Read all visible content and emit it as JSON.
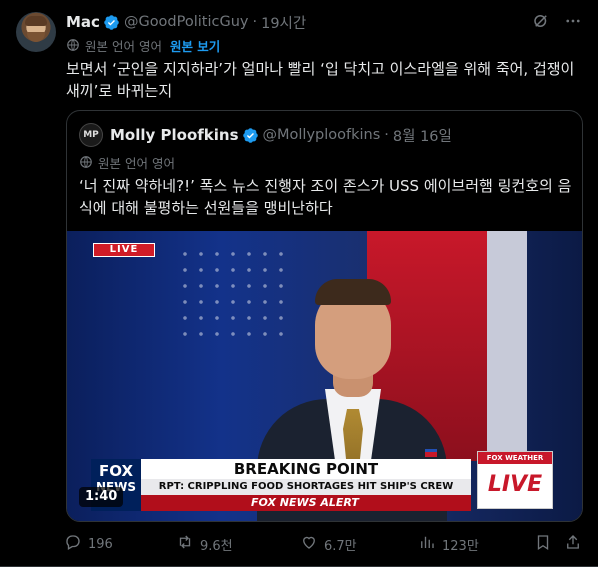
{
  "author": {
    "name": "Mac",
    "handle": "@GoodPoliticGuy",
    "separator": "·",
    "time": "19시간"
  },
  "translation": {
    "label": "원본 언어 영어",
    "show_original": "원본 보기"
  },
  "tweet_text": "보면서 ‘군인을 지지하라’가 얼마나 빨리 ‘입 닥치고 이스라엘을 위해 죽어, 겁쟁이 새끼’로 바뀌는지",
  "quoted": {
    "avatar_text": "MP",
    "name": "Molly Ploofkins",
    "handle": "@Mollyploofkins",
    "separator": "·",
    "date": "8월 16일",
    "translation_label": "원본 언어 영어",
    "text": "‘너 진짜 약하네?!’ 폭스 뉴스 진행자 조이 존스가 USS 에이브러햄 링컨호의 음식에 대해 불평하는 선원들을 맹비난하다"
  },
  "video": {
    "live_tag": "LIVE",
    "logo_line1": "FOX",
    "logo_line2": "NEWS",
    "chyron_title": "BREAKING POINT",
    "chyron_sub": "RPT: CRIPPLING FOOD SHORTAGES HIT SHIP'S CREW",
    "alert_text": "FOX NEWS ALERT",
    "weather_label": "FOX WEATHER",
    "weather_live": "LIVE",
    "duration": "1:40"
  },
  "stats": {
    "replies": "196",
    "reposts": "9.6천",
    "likes": "6.7만",
    "views": "123만"
  },
  "colors": {
    "background": "#000000",
    "text": "#e7e9ea",
    "muted": "#71767b",
    "accent": "#1d9bf0",
    "border": "#2f3336"
  },
  "icons": {
    "verified": "verified-badge-icon",
    "grok": "grok-icon",
    "more": "more-icon",
    "globe": "translate-globe-icon",
    "reply": "reply-icon",
    "repost": "repost-icon",
    "like": "like-icon",
    "views": "views-icon",
    "bookmark": "bookmark-icon",
    "share": "share-icon"
  }
}
